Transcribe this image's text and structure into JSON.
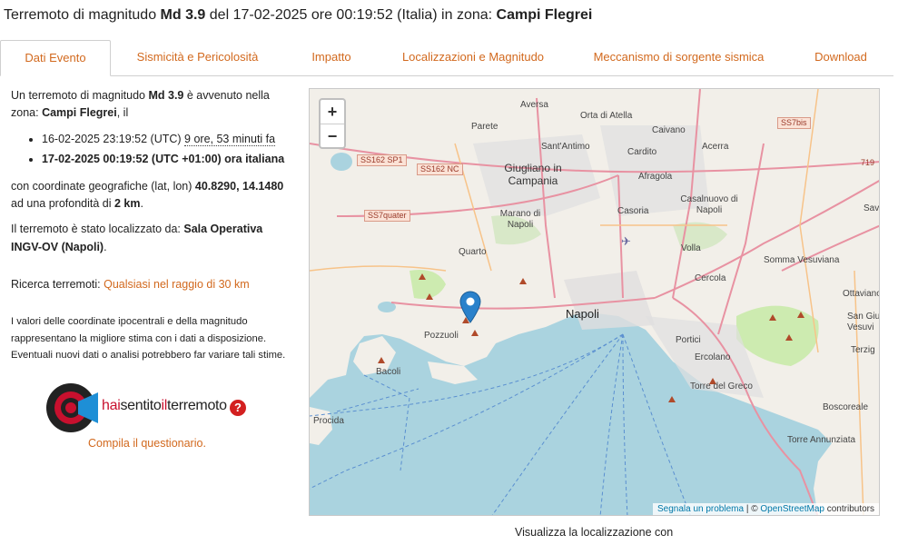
{
  "title": {
    "prefix": "Terremoto di magnitudo ",
    "magnitude": "Md 3.9",
    "middle": " del 17-02-2025 ore 00:19:52 (Italia) in zona: ",
    "zone": "Campi Flegrei"
  },
  "tabs": [
    {
      "label": "Dati Evento",
      "active": true
    },
    {
      "label": "Sismicità e Pericolosità"
    },
    {
      "label": "Impatto"
    },
    {
      "label": "Localizzazioni e Magnitudo"
    },
    {
      "label": "Meccanismo di sorgente sismica"
    },
    {
      "label": "Download"
    }
  ],
  "event": {
    "intro_pre": "Un terremoto di magnitudo ",
    "magnitude": "Md 3.9",
    "intro_mid": " è avvenuto nella zona: ",
    "zone": "Campi Flegrei",
    "intro_post": ", il",
    "utc_time": "16-02-2025 23:19:52 (UTC)",
    "ago": "9 ore, 53 minuti fa",
    "local_time": "17-02-2025 00:19:52 (UTC +01:00) ora italiana",
    "coords_pre": "con coordinate geografiche (lat, lon) ",
    "coords": "40.8290, 14.1480",
    "depth_pre": "ad una profondità di ",
    "depth": "2 km",
    "depth_post": ".",
    "located_pre": "Il terremoto è stato localizzato da: ",
    "located_by": "Sala Operativa INGV-OV (Napoli)",
    "located_post": ".",
    "search_label": "Ricerca terremoti: ",
    "search_link": "Qualsiasi nel raggio di 30 km",
    "disclaimer": "I valori delle coordinate ipocentrali e della magnitudo rappresentano la migliore stima con i dati a disposizione. Eventuali nuovi dati o analisi potrebbero far variare tali stime."
  },
  "hst": {
    "part1": "hai",
    "part2": "sentito",
    "part3": "il",
    "part4": "terremoto",
    "qmark": "?",
    "cta": "Compila il questionario."
  },
  "map": {
    "zoom_in": "+",
    "zoom_out": "−",
    "attribution_link1": "Segnala un problema",
    "attribution_sep": " | © ",
    "attribution_link2": "OpenStreetMap",
    "attribution_post": " contributors",
    "road_labels": [
      "SS162 SP1",
      "SS162 NC",
      "SS7quater",
      "SS7bis",
      "719"
    ],
    "places": [
      "Aversa",
      "Orta di Atella",
      "Caivano",
      "Acerra",
      "Parete",
      "Sant'Antimo",
      "Cardito",
      "Giugliano in Campania",
      "Afragola",
      "Casalnuovo di Napoli",
      "Marano di Napoli",
      "Casoria",
      "Savi",
      "Quarto",
      "Volla",
      "Somma Vesuviana",
      "Cercola",
      "Ottaviano",
      "Napoli",
      "San Giu Vesuvi",
      "Pozzuoli",
      "Portici",
      "Terzig",
      "Bacoli",
      "Ercolano",
      "Torre del Greco",
      "Boscoreale",
      "Procida",
      "Torre Annunziata"
    ]
  },
  "colors": {
    "accent": "#d2691e",
    "water": "#aad3df",
    "land": "#f2efe9",
    "marker": "#2a81cb"
  },
  "footer": {
    "viz_label": "Visualizza la localizzazione con"
  }
}
